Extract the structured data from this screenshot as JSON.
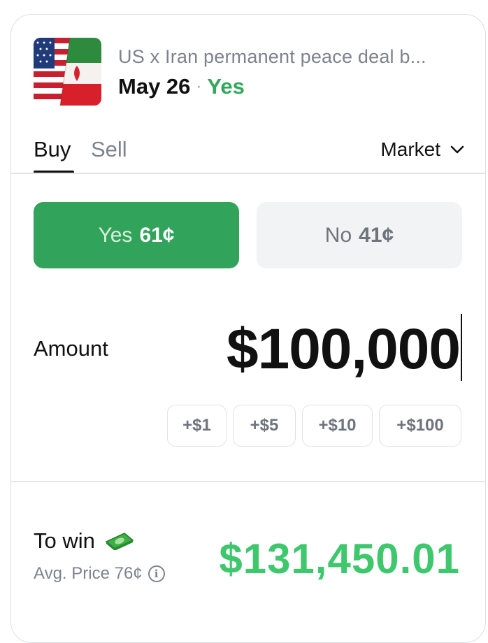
{
  "market": {
    "title": "US x Iran permanent peace deal b...",
    "date": "May 26",
    "separator": "·",
    "outcome": "Yes"
  },
  "tabs": {
    "buy": "Buy",
    "sell": "Sell"
  },
  "order_type": {
    "value": "Market"
  },
  "outcomes": {
    "yes": {
      "label": "Yes",
      "price": "61¢"
    },
    "no": {
      "label": "No",
      "price": "41¢"
    }
  },
  "amount": {
    "label": "Amount",
    "value": "$100,000"
  },
  "quick_add": [
    "+$1",
    "+$5",
    "+$10",
    "+$100"
  ],
  "summary": {
    "to_win_label": "To win",
    "avg_price": "Avg. Price 76¢",
    "payout": "$131,450.01"
  },
  "colors": {
    "accent_green": "#32a35a",
    "payout_green": "#3fc76d",
    "muted_text": "#7d838c"
  },
  "icons": {
    "market_thumbnail": "us-iran-flags-image",
    "dropdown": "chevron-down-icon",
    "money": "money-bill-icon",
    "info": "info-circle-icon"
  }
}
